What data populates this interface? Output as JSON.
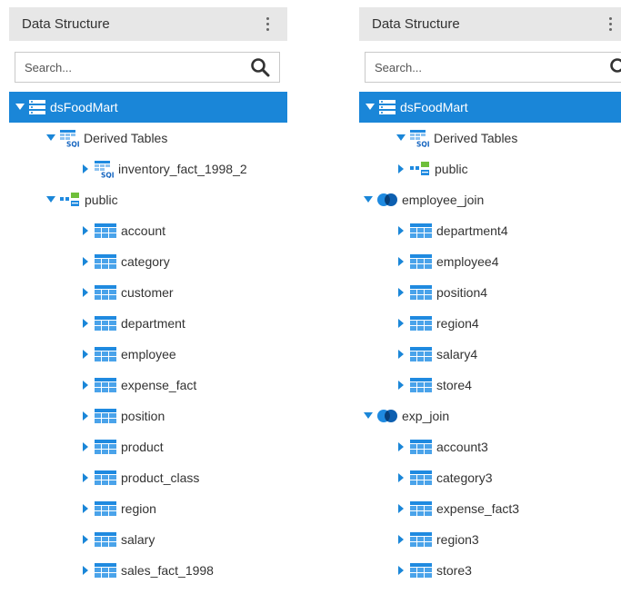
{
  "left": {
    "header": {
      "title": "Data Structure"
    },
    "search": {
      "placeholder": "Search..."
    },
    "tree": {
      "root": "dsFoodMart",
      "derived": "Derived Tables",
      "derived_item": "inventory_fact_1998_2",
      "public": "public",
      "tables": [
        "account",
        "category",
        "customer",
        "department",
        "employee",
        "expense_fact",
        "position",
        "product",
        "product_class",
        "region",
        "salary",
        "sales_fact_1998"
      ]
    }
  },
  "right": {
    "header": {
      "title": "Data Structure"
    },
    "search": {
      "placeholder": "Search..."
    },
    "tree": {
      "root": "dsFoodMart",
      "derived": "Derived Tables",
      "public": "public",
      "employee_join": {
        "label": "employee_join",
        "tables": [
          "department4",
          "employee4",
          "position4",
          "region4",
          "salary4",
          "store4"
        ]
      },
      "exp_join": {
        "label": "exp_join",
        "tables": [
          "account3",
          "category3",
          "expense_fact3",
          "region3",
          "store3"
        ]
      }
    }
  },
  "colors": {
    "selected_bg": "#1a86d8",
    "header_bg": "#e7e7e7",
    "icon_blue": "#1f8ae0",
    "icon_green": "#6fbf3b"
  }
}
